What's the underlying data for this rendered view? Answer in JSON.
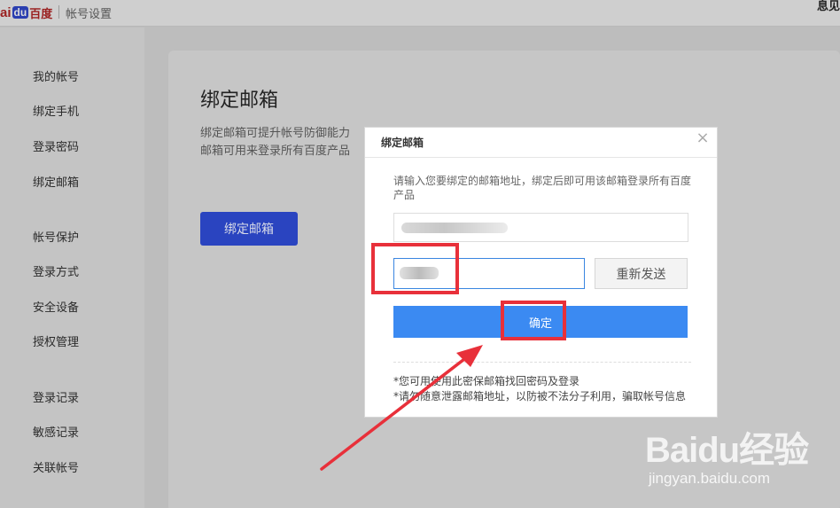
{
  "header": {
    "logo_left": "ai",
    "logo_du": "du",
    "logo_right": "百度",
    "title": "帐号设置",
    "right_text": "息见"
  },
  "sidebar": {
    "items": [
      {
        "label": "我的帐号"
      },
      {
        "label": "绑定手机"
      },
      {
        "label": "登录密码"
      },
      {
        "label": "绑定邮箱"
      },
      {
        "label": "帐号保护"
      },
      {
        "label": "登录方式"
      },
      {
        "label": "安全设备"
      },
      {
        "label": "授权管理"
      },
      {
        "label": "登录记录"
      },
      {
        "label": "敏感记录"
      },
      {
        "label": "关联帐号"
      }
    ]
  },
  "main": {
    "title": "绑定邮箱",
    "desc_line1": "绑定邮箱可提升帐号防御能力",
    "desc_line2": "邮箱可用来登录所有百度产品",
    "bind_button": "绑定邮箱"
  },
  "modal": {
    "title": "绑定邮箱",
    "close_icon": "×",
    "intro": "请输入您要绑定的邮箱地址，绑定后即可用该邮箱登录所有百度产品",
    "email_value": "",
    "code_value": "",
    "resend_button": "重新发送",
    "confirm_button": "确定",
    "note1": "*您可用使用此密保邮箱找回密码及登录",
    "note2": "*请勿随意泄露邮箱地址，以防被不法分子利用，骗取帐号信息"
  },
  "watermark": {
    "brand": "Baidu经验",
    "url": "jingyan.baidu.com"
  },
  "colors": {
    "accent": "#3b8af2",
    "annotation": "#e8303a",
    "bind_button": "#2a44c0"
  }
}
